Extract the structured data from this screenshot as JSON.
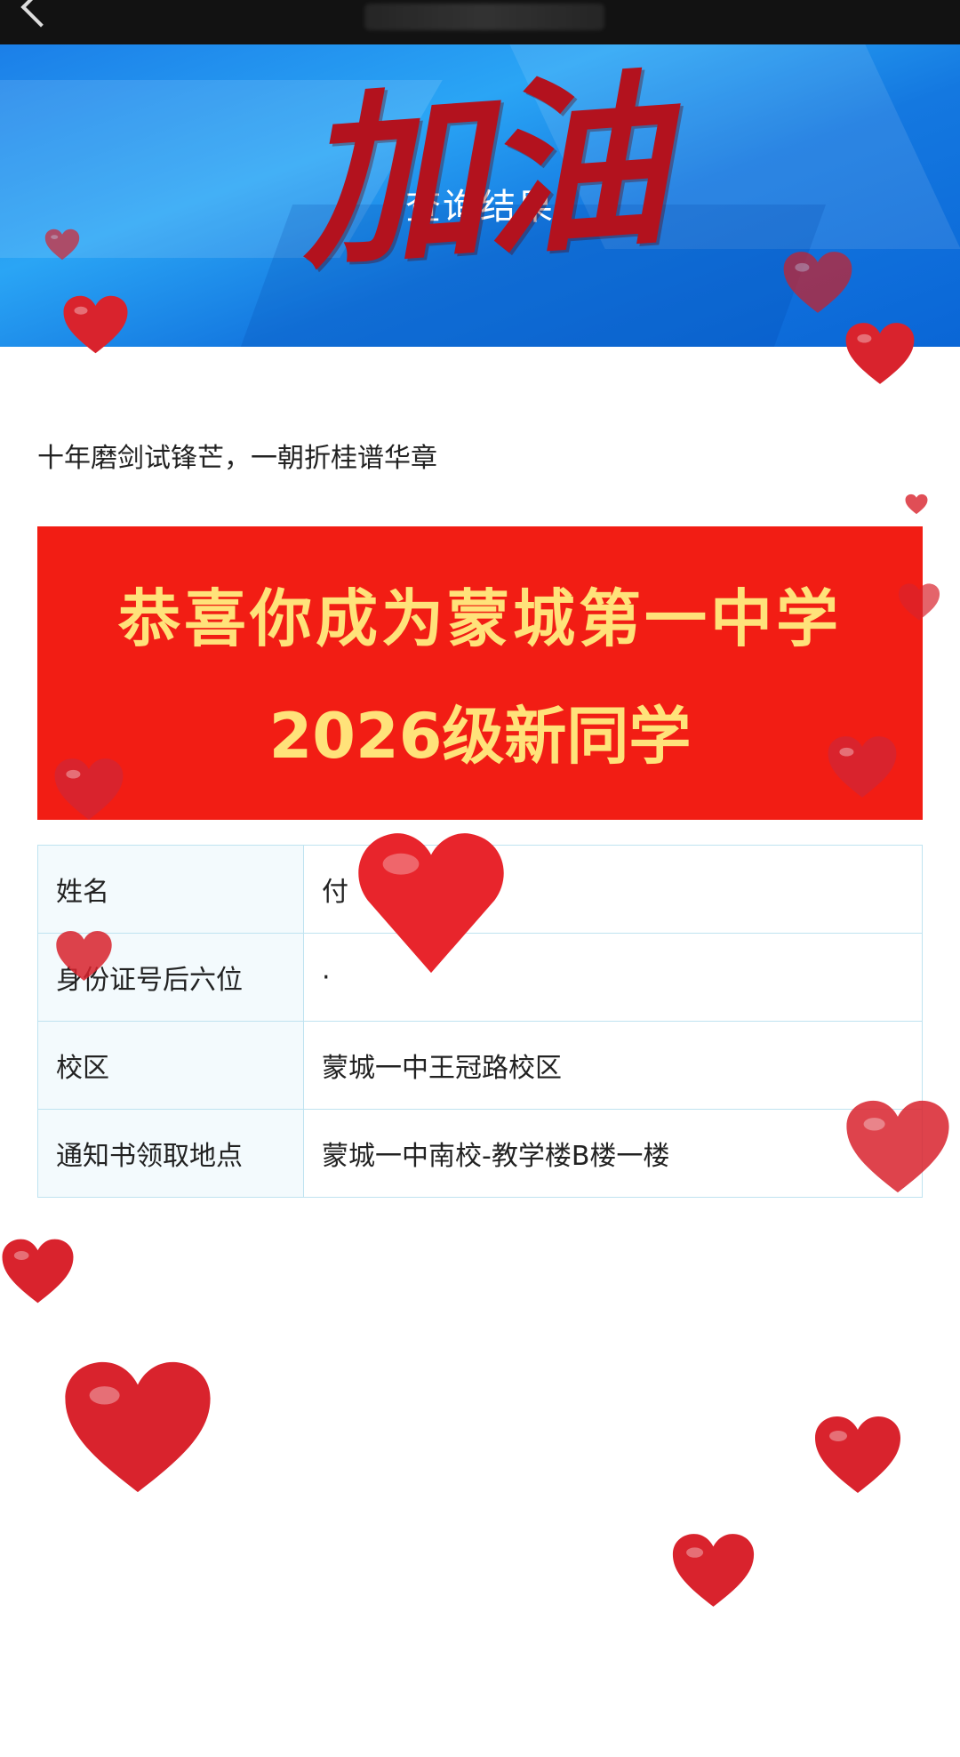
{
  "hero": {
    "title": "查询结果",
    "overlay_text": "加油"
  },
  "motto": "十年磨剑试锋芒，一朝折桂谱华章",
  "banner": {
    "line1": "恭喜你成为蒙城第一中学",
    "line2": "2026级新同学"
  },
  "info_rows": [
    {
      "label": "姓名",
      "value": "付"
    },
    {
      "label": "身份证号后六位",
      "value": "·"
    },
    {
      "label": "校区",
      "value": "蒙城一中王冠路校区"
    },
    {
      "label": "通知书领取地点",
      "value": "蒙城一中南校-教学楼B楼一楼"
    }
  ],
  "colors": {
    "hero_blue": "#1b7fe8",
    "banner_red": "#f21d14",
    "banner_text": "#ffe27a",
    "heart_red": "#d9232d",
    "table_border": "#bfe3f0"
  },
  "decorations": {
    "heart_icon": "heart-icon"
  }
}
